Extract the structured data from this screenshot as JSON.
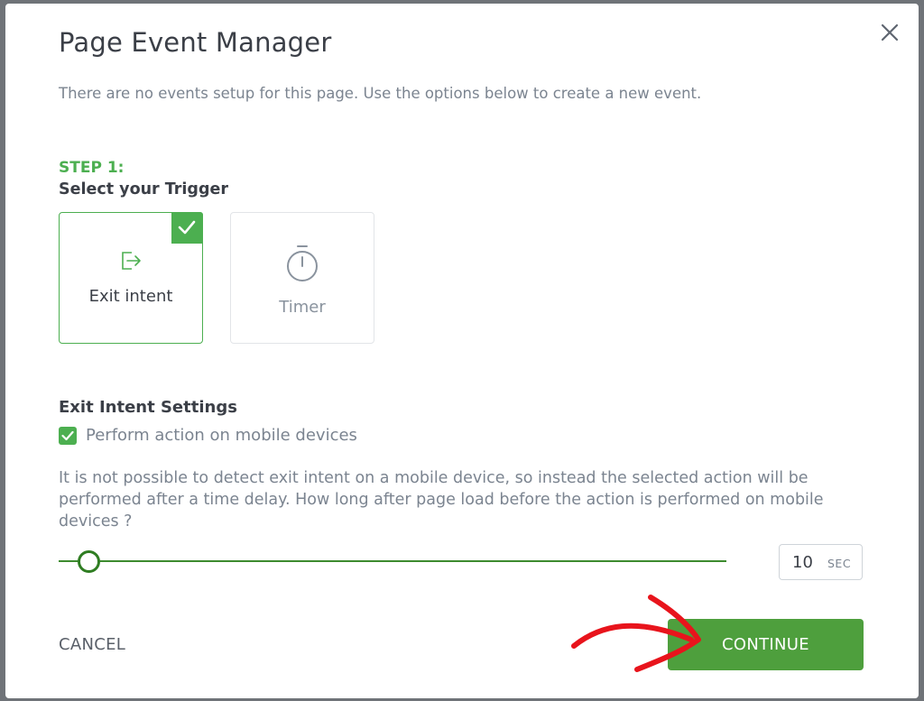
{
  "modal": {
    "title": "Page Event Manager",
    "subtitle": "There are no events setup for this page. Use the options below to create a new event.",
    "close_icon": "close-icon"
  },
  "step": {
    "label": "STEP 1:",
    "title": "Select your Trigger"
  },
  "triggers": [
    {
      "label": "Exit intent",
      "icon": "exit-icon",
      "selected": true
    },
    {
      "label": "Timer",
      "icon": "stopwatch-icon",
      "selected": false
    }
  ],
  "settings": {
    "title": "Exit Intent Settings",
    "mobile_checkbox_label": "Perform action on mobile devices",
    "mobile_checkbox_checked": true,
    "help_text": "It is not possible to detect exit intent on a mobile device, so instead the selected action will be performed after a time delay. How long after page load before the action is performed on mobile devices ?",
    "delay_value": "10",
    "delay_unit": "SEC"
  },
  "actions": {
    "cancel_label": "CANCEL",
    "continue_label": "CONTINUE"
  },
  "colors": {
    "accent": "#4caf50",
    "button": "#4e9f3d",
    "annotation": "#e8141c"
  }
}
